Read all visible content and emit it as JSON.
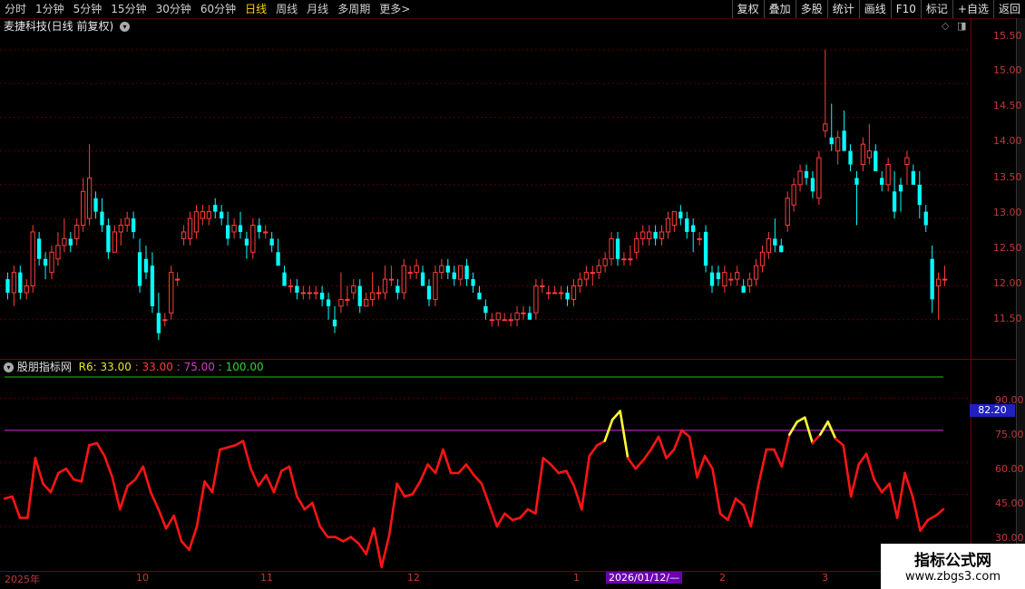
{
  "toolbar": {
    "periods": [
      "分时",
      "1分钟",
      "5分钟",
      "15分钟",
      "30分钟",
      "60分钟",
      "日线",
      "周线",
      "月线",
      "多周期",
      "更多"
    ],
    "active": "日线",
    "more_arrow": ">",
    "right_buttons": [
      "复权",
      "叠加",
      "多股",
      "统计",
      "画线",
      "F10",
      "标记",
      "+自选",
      "返回"
    ]
  },
  "chart_header": {
    "title": "麦捷科技(日线 前复权)"
  },
  "price_axis": [
    "15.50",
    "15.00",
    "14.50",
    "14.00",
    "13.50",
    "13.00",
    "12.50",
    "12.00",
    "11.50"
  ],
  "indicator": {
    "name": "股朋指标网",
    "r_label": "R6: 33.00",
    "v1": ": 33.00",
    "v2": ": 75.00",
    "v3": ": 100.00",
    "axis": [
      "90.00",
      "75.00",
      "60.00",
      "45.00",
      "30.00"
    ],
    "cursor_value": "82.20",
    "line_colors": {
      "main": "#ff1414",
      "hot": "#ffff32",
      "upper": "#1fbf1f",
      "ref": "#b91eb9"
    }
  },
  "date_axis": [
    "2025年",
    "10",
    "11",
    "12",
    "1",
    "2",
    "3"
  ],
  "cursor_date": "2026/01/12/—",
  "watermark": {
    "title": "指标公式网",
    "url": "www.zbgs3.com"
  },
  "colors": {
    "up": "#ff3c3c",
    "down": "#00ffff",
    "bg": "#000000",
    "grid": "#5a0000"
  },
  "chart_data": {
    "type": "candlestick",
    "ylim": [
      11.0,
      15.7
    ],
    "candles": [
      [
        12.1,
        12.2,
        11.8,
        11.9
      ],
      [
        11.9,
        12.3,
        11.7,
        12.2
      ],
      [
        12.2,
        12.3,
        11.8,
        11.9
      ],
      [
        11.9,
        12.1,
        11.8,
        12.0
      ],
      [
        12.0,
        12.9,
        11.9,
        12.8
      ],
      [
        12.7,
        12.8,
        12.3,
        12.4
      ],
      [
        12.4,
        12.5,
        12.1,
        12.3
      ],
      [
        12.2,
        12.6,
        12.1,
        12.5
      ],
      [
        12.4,
        12.8,
        12.3,
        12.6
      ],
      [
        12.6,
        13.0,
        12.5,
        12.7
      ],
      [
        12.7,
        12.8,
        12.5,
        12.6
      ],
      [
        12.7,
        13.0,
        12.6,
        12.9
      ],
      [
        12.9,
        13.6,
        12.8,
        13.4
      ],
      [
        13.0,
        14.1,
        12.9,
        13.6
      ],
      [
        13.3,
        13.4,
        13.0,
        13.1
      ],
      [
        13.1,
        13.3,
        12.8,
        12.9
      ],
      [
        12.9,
        13.0,
        12.4,
        12.5
      ],
      [
        12.5,
        12.9,
        12.5,
        12.8
      ],
      [
        12.8,
        13.0,
        12.6,
        12.9
      ],
      [
        12.9,
        13.1,
        12.8,
        13.0
      ],
      [
        13.0,
        13.1,
        12.7,
        12.8
      ],
      [
        12.5,
        12.7,
        11.9,
        12.0
      ],
      [
        12.4,
        12.6,
        12.1,
        12.2
      ],
      [
        12.3,
        12.5,
        11.6,
        11.7
      ],
      [
        11.6,
        11.9,
        11.2,
        11.3
      ],
      [
        11.5,
        11.6,
        11.4,
        11.5
      ],
      [
        11.6,
        12.3,
        11.5,
        12.2
      ],
      [
        12.1,
        12.2,
        12.0,
        12.1
      ],
      [
        12.7,
        12.9,
        12.6,
        12.8
      ],
      [
        12.7,
        13.1,
        12.6,
        13.0
      ],
      [
        12.8,
        13.2,
        12.7,
        13.1
      ],
      [
        13.0,
        13.2,
        12.9,
        13.1
      ],
      [
        13.0,
        13.2,
        12.9,
        13.1
      ],
      [
        13.2,
        13.3,
        13.0,
        13.1
      ],
      [
        13.1,
        13.2,
        12.9,
        13.0
      ],
      [
        12.9,
        13.1,
        12.6,
        12.7
      ],
      [
        12.8,
        13.0,
        12.7,
        12.9
      ],
      [
        12.9,
        13.1,
        12.7,
        12.8
      ],
      [
        12.7,
        12.8,
        12.4,
        12.6
      ],
      [
        12.5,
        13.0,
        12.4,
        12.9
      ],
      [
        12.9,
        13.0,
        12.7,
        12.8
      ],
      [
        12.8,
        12.9,
        12.7,
        12.8
      ],
      [
        12.7,
        12.8,
        12.5,
        12.6
      ],
      [
        12.5,
        12.7,
        12.3,
        12.3
      ],
      [
        12.2,
        12.3,
        12.0,
        12.0
      ],
      [
        12.0,
        12.1,
        11.9,
        12.0
      ],
      [
        12.0,
        12.1,
        11.8,
        11.9
      ],
      [
        11.9,
        12.0,
        11.8,
        11.9
      ],
      [
        11.9,
        12.0,
        11.8,
        11.9
      ],
      [
        11.9,
        12.0,
        11.8,
        11.9
      ],
      [
        11.9,
        12.0,
        11.7,
        11.8
      ],
      [
        11.8,
        11.9,
        11.5,
        11.7
      ],
      [
        11.5,
        11.7,
        11.3,
        11.4
      ],
      [
        11.7,
        12.2,
        11.6,
        11.8
      ],
      [
        11.8,
        12.0,
        11.7,
        11.8
      ],
      [
        11.9,
        12.1,
        11.8,
        12.0
      ],
      [
        12.0,
        12.1,
        11.6,
        11.7
      ],
      [
        11.7,
        11.9,
        11.7,
        11.8
      ],
      [
        11.8,
        12.2,
        11.7,
        11.9
      ],
      [
        11.9,
        12.0,
        11.8,
        11.9
      ],
      [
        11.9,
        12.3,
        11.8,
        12.1
      ],
      [
        12.1,
        12.3,
        12.0,
        12.1
      ],
      [
        12.0,
        12.1,
        11.8,
        11.9
      ],
      [
        11.9,
        12.4,
        11.8,
        12.3
      ],
      [
        12.2,
        12.3,
        12.1,
        12.2
      ],
      [
        12.2,
        12.4,
        12.1,
        12.3
      ],
      [
        12.2,
        12.3,
        12.0,
        12.0
      ],
      [
        12.0,
        12.1,
        11.7,
        11.8
      ],
      [
        11.8,
        12.3,
        11.7,
        12.2
      ],
      [
        12.2,
        12.4,
        12.1,
        12.3
      ],
      [
        12.3,
        12.4,
        12.1,
        12.2
      ],
      [
        12.2,
        12.3,
        12.0,
        12.1
      ],
      [
        12.1,
        12.3,
        12.0,
        12.3
      ],
      [
        12.3,
        12.4,
        12.0,
        12.1
      ],
      [
        12.1,
        12.2,
        11.9,
        12.0
      ],
      [
        11.9,
        12.0,
        11.8,
        11.8
      ],
      [
        11.7,
        11.8,
        11.5,
        11.6
      ],
      [
        11.5,
        11.6,
        11.4,
        11.5
      ],
      [
        11.5,
        11.6,
        11.4,
        11.6
      ],
      [
        11.5,
        11.6,
        11.5,
        11.5
      ],
      [
        11.5,
        11.6,
        11.4,
        11.5
      ],
      [
        11.5,
        11.7,
        11.4,
        11.6
      ],
      [
        11.6,
        11.7,
        11.5,
        11.6
      ],
      [
        11.6,
        11.7,
        11.5,
        11.5
      ],
      [
        11.6,
        12.1,
        11.5,
        12.0
      ],
      [
        12.0,
        12.1,
        11.9,
        12.0
      ],
      [
        11.9,
        12.0,
        11.8,
        11.9
      ],
      [
        11.9,
        12.0,
        11.9,
        11.9
      ],
      [
        11.9,
        12.0,
        11.8,
        11.9
      ],
      [
        11.9,
        12.0,
        11.7,
        11.8
      ],
      [
        11.8,
        12.1,
        11.7,
        12.0
      ],
      [
        12.0,
        12.2,
        11.9,
        12.1
      ],
      [
        12.1,
        12.3,
        12.0,
        12.2
      ],
      [
        12.2,
        12.3,
        12.0,
        12.2
      ],
      [
        12.2,
        12.4,
        12.1,
        12.3
      ],
      [
        12.3,
        12.5,
        12.2,
        12.4
      ],
      [
        12.4,
        12.8,
        12.3,
        12.7
      ],
      [
        12.7,
        12.8,
        12.3,
        12.4
      ],
      [
        12.4,
        12.5,
        12.3,
        12.4
      ],
      [
        12.4,
        12.6,
        12.3,
        12.4
      ],
      [
        12.5,
        12.8,
        12.4,
        12.7
      ],
      [
        12.7,
        12.9,
        12.6,
        12.8
      ],
      [
        12.7,
        12.9,
        12.6,
        12.8
      ],
      [
        12.8,
        12.9,
        12.6,
        12.7
      ],
      [
        12.7,
        12.9,
        12.6,
        12.8
      ],
      [
        12.8,
        13.1,
        12.7,
        13.0
      ],
      [
        12.9,
        13.1,
        12.8,
        13.1
      ],
      [
        13.1,
        13.2,
        12.9,
        13.0
      ],
      [
        13.0,
        13.1,
        12.7,
        12.8
      ],
      [
        12.9,
        13.0,
        12.5,
        12.8
      ],
      [
        12.7,
        12.8,
        12.6,
        12.7
      ],
      [
        12.8,
        12.9,
        12.2,
        12.3
      ],
      [
        12.2,
        12.3,
        11.9,
        12.0
      ],
      [
        12.2,
        12.3,
        12.0,
        12.1
      ],
      [
        12.0,
        12.3,
        11.9,
        12.2
      ],
      [
        12.1,
        12.2,
        12.0,
        12.1
      ],
      [
        12.1,
        12.3,
        12.0,
        12.2
      ],
      [
        12.0,
        12.1,
        11.9,
        11.9
      ],
      [
        12.0,
        12.2,
        11.9,
        12.1
      ],
      [
        12.1,
        12.4,
        12.0,
        12.3
      ],
      [
        12.3,
        12.6,
        12.2,
        12.5
      ],
      [
        12.5,
        12.8,
        12.4,
        12.7
      ],
      [
        12.7,
        13.0,
        12.5,
        12.6
      ],
      [
        12.6,
        12.7,
        12.5,
        12.5
      ],
      [
        12.9,
        13.4,
        12.8,
        13.3
      ],
      [
        13.2,
        13.6,
        13.1,
        13.5
      ],
      [
        13.5,
        13.8,
        13.4,
        13.7
      ],
      [
        13.7,
        13.8,
        13.5,
        13.6
      ],
      [
        13.6,
        13.7,
        13.3,
        13.4
      ],
      [
        13.3,
        14.0,
        13.2,
        13.9
      ],
      [
        14.3,
        15.5,
        14.2,
        14.4
      ],
      [
        14.2,
        14.7,
        14.0,
        14.1
      ],
      [
        14.0,
        14.3,
        13.8,
        14.2
      ],
      [
        14.3,
        14.6,
        14.0,
        14.0
      ],
      [
        14.0,
        14.1,
        13.7,
        13.8
      ],
      [
        13.6,
        13.7,
        12.9,
        13.5
      ],
      [
        13.8,
        14.2,
        13.7,
        14.1
      ],
      [
        13.9,
        14.4,
        13.8,
        14.0
      ],
      [
        14.0,
        14.1,
        13.7,
        13.7
      ],
      [
        13.6,
        13.7,
        13.4,
        13.5
      ],
      [
        13.5,
        13.9,
        13.4,
        13.8
      ],
      [
        13.4,
        13.7,
        13.0,
        13.1
      ],
      [
        13.5,
        13.6,
        13.1,
        13.4
      ],
      [
        13.8,
        14.0,
        13.5,
        13.9
      ],
      [
        13.7,
        13.8,
        13.5,
        13.5
      ],
      [
        13.5,
        13.7,
        13.0,
        13.2
      ],
      [
        13.1,
        13.2,
        12.8,
        12.9
      ],
      [
        12.4,
        12.6,
        11.6,
        11.8
      ],
      [
        12.0,
        12.2,
        11.5,
        12.1
      ],
      [
        12.1,
        12.3,
        12.0,
        12.1
      ]
    ],
    "indicator_series": [
      43,
      44,
      34,
      34,
      62,
      50,
      46,
      55,
      57,
      52,
      51,
      68,
      69,
      63,
      53,
      38,
      49,
      52,
      58,
      46,
      38,
      29,
      35,
      23,
      19,
      30,
      51,
      46,
      66,
      67,
      68,
      70,
      57,
      49,
      54,
      46,
      56,
      58,
      44,
      38,
      41,
      30,
      25,
      25,
      23,
      25,
      22,
      17,
      29,
      11,
      26,
      50,
      44,
      45,
      51,
      59,
      55,
      66,
      55,
      55,
      59,
      54,
      50,
      40,
      30,
      36,
      33,
      34,
      38,
      36,
      62,
      59,
      55,
      56,
      49,
      38,
      63,
      68,
      70,
      80,
      84,
      62,
      57,
      61,
      66,
      72,
      62,
      66,
      75,
      72,
      53,
      63,
      57,
      36,
      33,
      43,
      40,
      30,
      50,
      66,
      66,
      58,
      73,
      79,
      81,
      69,
      73,
      79,
      71,
      68,
      44,
      59,
      64,
      52,
      46,
      50,
      34,
      55,
      44,
      28,
      33,
      35,
      38
    ]
  }
}
